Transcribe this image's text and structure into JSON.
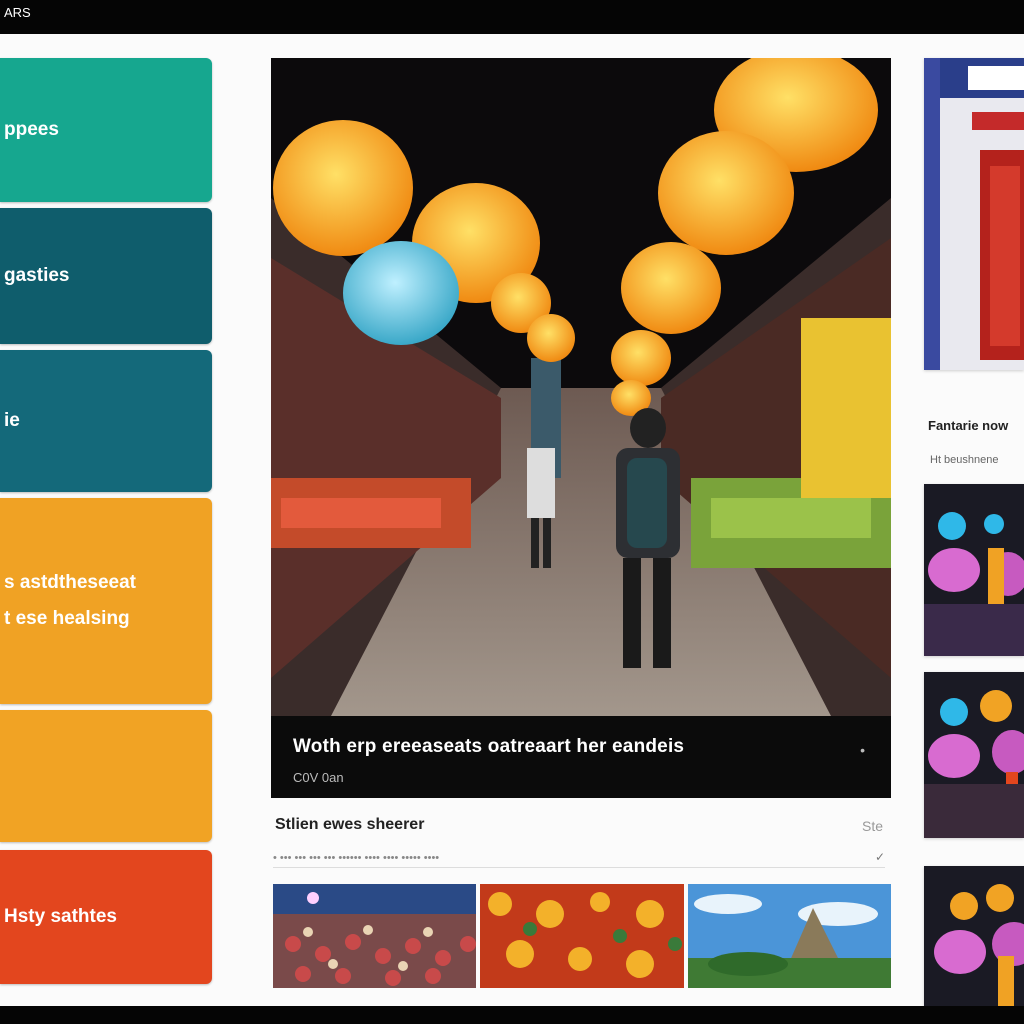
{
  "window": {
    "title": "ARS"
  },
  "sidebar": {
    "items": [
      {
        "label": "ppees",
        "color": "#16a78f"
      },
      {
        "label": "gasties",
        "color": "#0f5d6c"
      },
      {
        "label": "ie",
        "color": "#14697a"
      },
      {
        "label": "s astdtheseeat",
        "label2": "t ese healsing",
        "color": "#f0a224"
      },
      {
        "label": "",
        "color": "#f1a324"
      },
      {
        "label": "Hsty sathtes",
        "color": "#e3461e"
      }
    ]
  },
  "hero": {
    "title": "Woth erp ereeaseats oatreaart her eandeis",
    "subtitle": "C0V 0an",
    "more": "•"
  },
  "section": {
    "title": "Stlien ewes sheerer",
    "action": "Ste",
    "filters": "• ••• ••• ••• ••• •••••• •••• •••• ••••• ••••",
    "chevron": "✓",
    "thumbnails": [
      "crowd-festival",
      "red-gold-pattern",
      "mountain-temple"
    ]
  },
  "right": {
    "title": "Fantarie now",
    "subtitle": "Ht beushnene",
    "cards": [
      "temple-doorway",
      "lantern-figures-1",
      "lantern-figures-2",
      "lantern-figures-3"
    ]
  },
  "colors": {
    "teal": "#16a78f",
    "dark_teal": "#0f5d6c",
    "orange": "#f0a224",
    "red": "#e3461e"
  }
}
